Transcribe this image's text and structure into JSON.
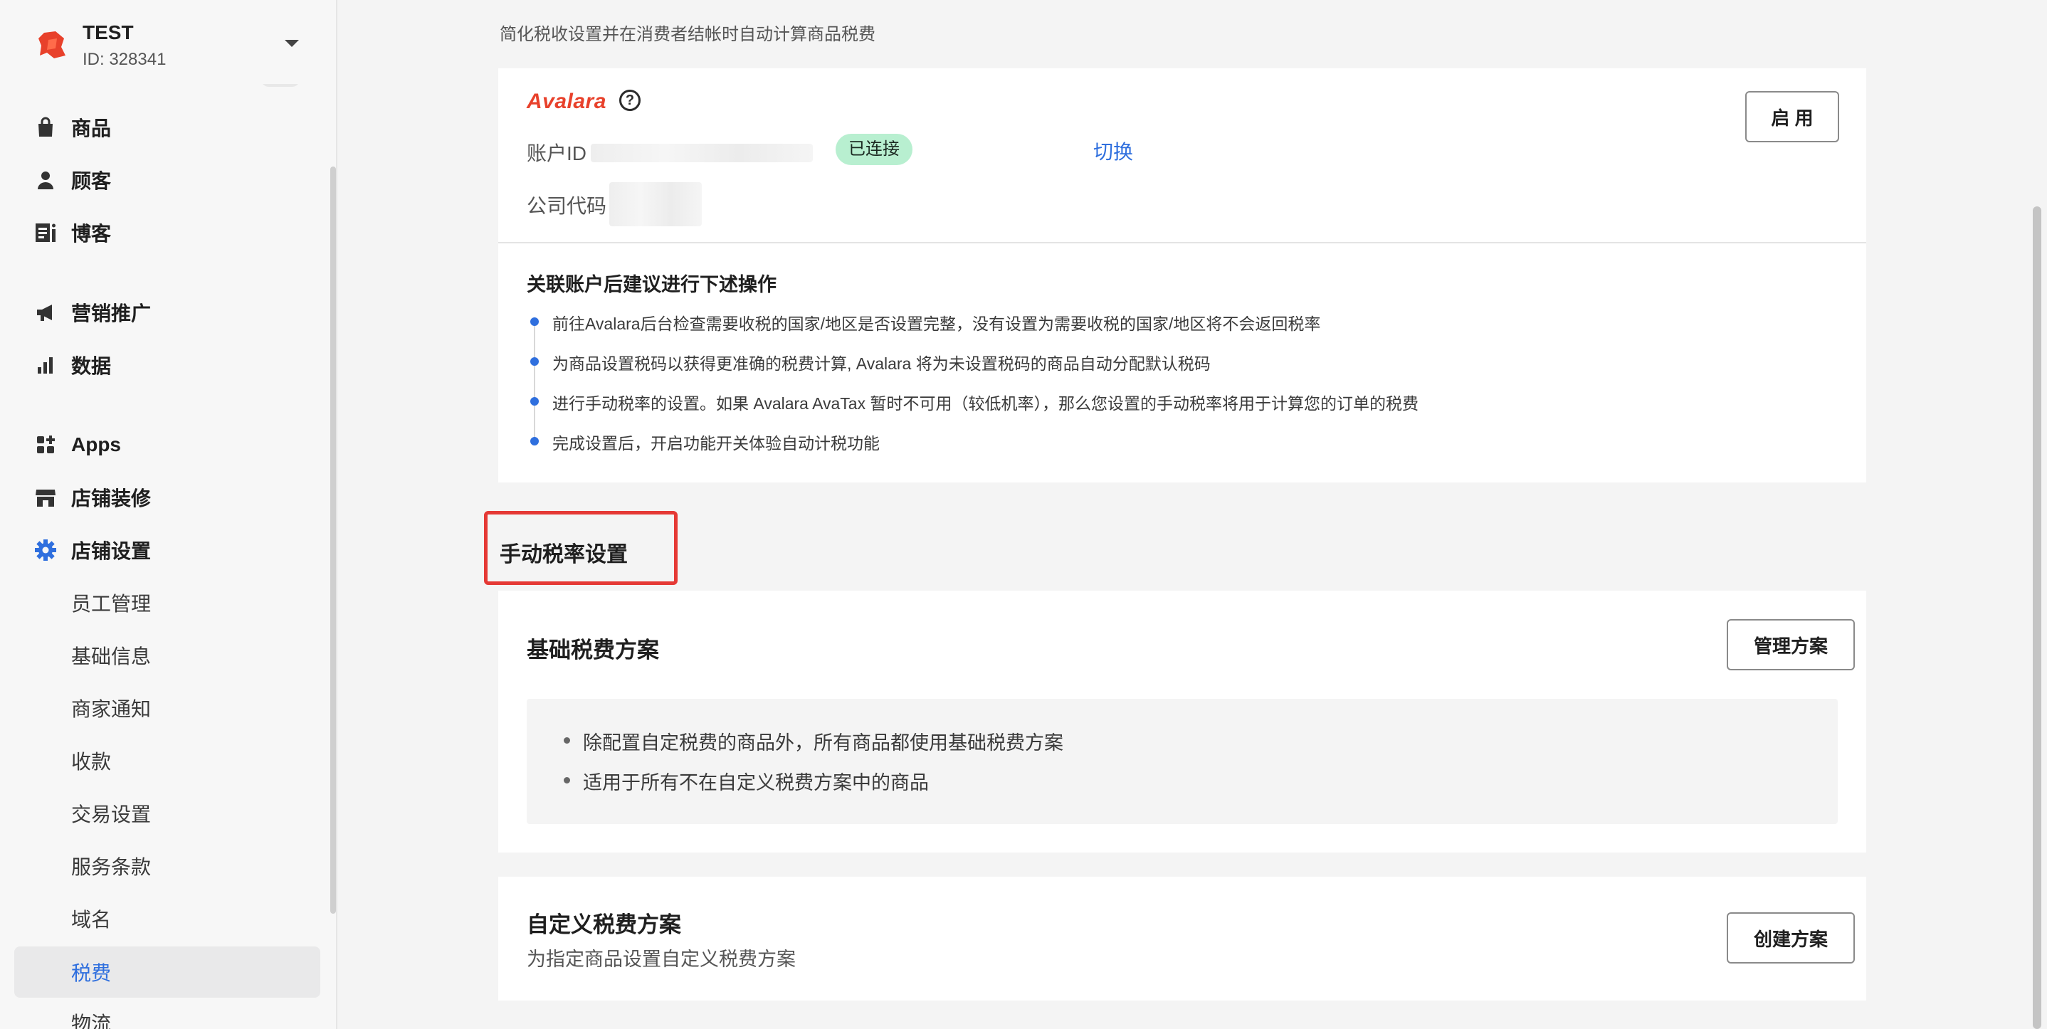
{
  "store": {
    "name": "TEST",
    "id_label": "ID: 328341"
  },
  "sidebar": {
    "items": [
      {
        "label": "商品",
        "icon": "bag-icon"
      },
      {
        "label": "顾客",
        "icon": "person-icon"
      },
      {
        "label": "博客",
        "icon": "blog-icon"
      },
      {
        "label": "营销推广",
        "icon": "megaphone-icon"
      },
      {
        "label": "数据",
        "icon": "bar-chart-icon"
      },
      {
        "label": "Apps",
        "icon": "apps-grid-icon"
      },
      {
        "label": "店铺装修",
        "icon": "storefront-icon"
      },
      {
        "label": "店铺设置",
        "icon": "gear-icon"
      }
    ],
    "settings_sub": [
      {
        "label": "员工管理"
      },
      {
        "label": "基础信息"
      },
      {
        "label": "商家通知"
      },
      {
        "label": "收款"
      },
      {
        "label": "交易设置"
      },
      {
        "label": "服务条款"
      },
      {
        "label": "域名"
      },
      {
        "label": "税费",
        "active": true
      },
      {
        "label": "物流"
      }
    ]
  },
  "header": {
    "subtitle": "简化税收设置并在消费者结帐时自动计算商品税费"
  },
  "avalara": {
    "logo_text": "Avalara",
    "help_icon": "question-circle-icon",
    "account_id_label": "账户ID",
    "status_badge": "已连接",
    "switch_link": "切换",
    "company_code_label": "公司代码",
    "enable_button": "启 用",
    "steps_title": "关联账户后建议进行下述操作",
    "steps": [
      "前往Avalara后台检查需要收税的国家/地区是否设置完整，没有设置为需要收税的国家/地区将不会返回税率",
      "为商品设置税码以获得更准确的税费计算, Avalara 将为未设置税码的商品自动分配默认税码",
      "进行手动税率的设置。如果 Avalara AvaTax 暂时不可用（较低机率），那么您设置的手动税率将用于计算您的订单的税费",
      "完成设置后，开启功能开关体验自动计税功能"
    ]
  },
  "manual": {
    "section_title": "手动税率设置",
    "base_plan": {
      "title": "基础税费方案",
      "button": "管理方案",
      "notes": [
        "除配置自定税费的商品外，所有商品都使用基础税费方案",
        "适用于所有不在自定义税费方案中的商品"
      ]
    },
    "custom_plan": {
      "title": "自定义税费方案",
      "description": "为指定商品设置自定义税费方案",
      "button": "创建方案"
    }
  },
  "colors": {
    "accent": "#2f6fde",
    "connected_bg": "#b8efd0",
    "highlight_border": "#e53935",
    "avalara_brand": "#e8412b"
  }
}
